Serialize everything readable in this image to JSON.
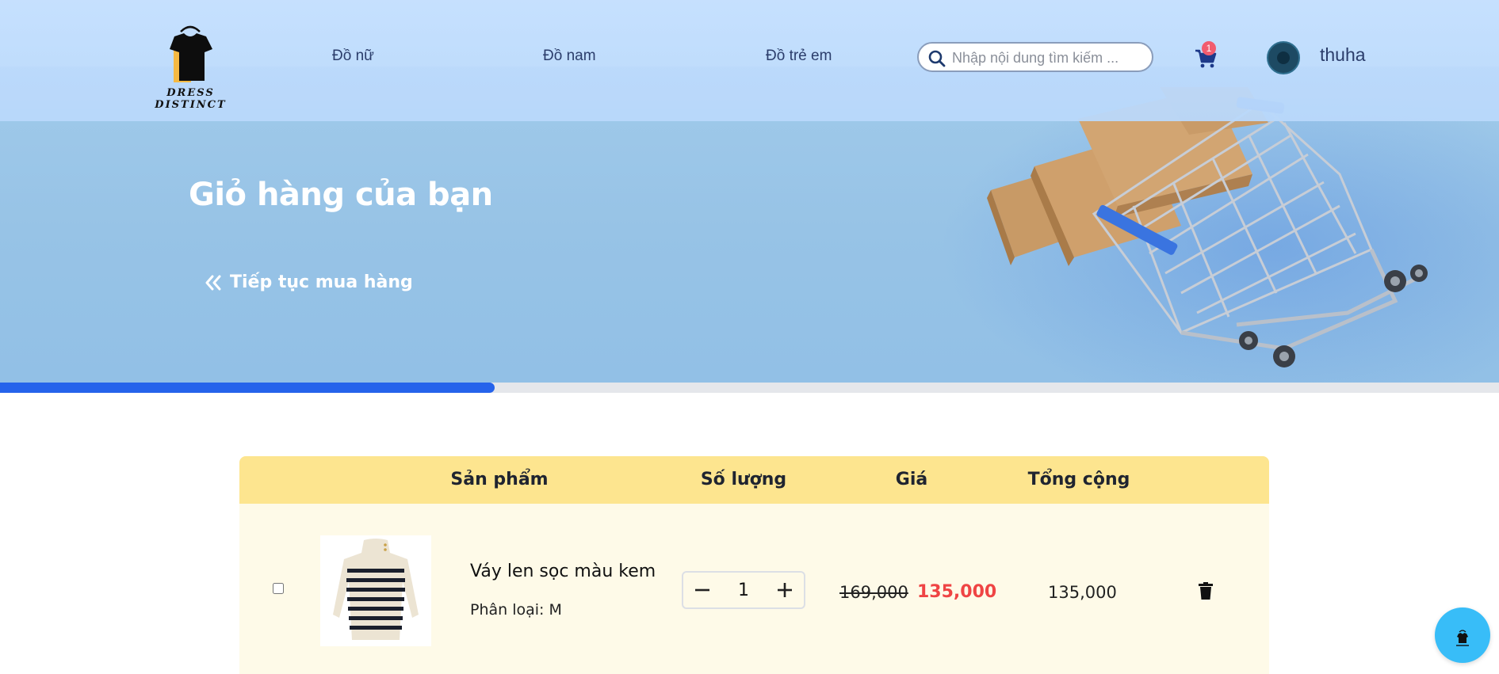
{
  "header": {
    "logo_text": "DRESS DISTINCT",
    "nav": [
      "Đồ nữ",
      "Đồ nam",
      "Đồ trẻ em"
    ],
    "search_placeholder": "Nhập nội dung tìm kiếm ...",
    "cart_count": "1",
    "username": "thuha"
  },
  "banner": {
    "title": "Giỏ hàng của bạn",
    "continue_label": "Tiếp tục mua hàng"
  },
  "progress": {
    "fraction": 0.33
  },
  "table": {
    "headers": {
      "product": "Sản phẩm",
      "quantity": "Số lượng",
      "price": "Giá",
      "total": "Tổng cộng"
    },
    "items": [
      {
        "name": "Váy len sọc màu kem",
        "variant": "Phân loại: M",
        "quantity": "1",
        "old_price": "169,000",
        "price": "135,000",
        "total": "135,000"
      }
    ]
  },
  "colors": {
    "accent_blue": "#2563eb",
    "header_bg": "#c7e1ff",
    "table_header": "#fde58f",
    "row_bg": "#fefae8",
    "price_red": "#ef4444"
  },
  "icons": {
    "search": "search-icon",
    "cart": "cart-icon",
    "continue": "double-chevron-left-icon",
    "minus": "minus-icon",
    "plus": "plus-icon",
    "delete": "trash-icon",
    "chat": "chat-fab-icon"
  }
}
